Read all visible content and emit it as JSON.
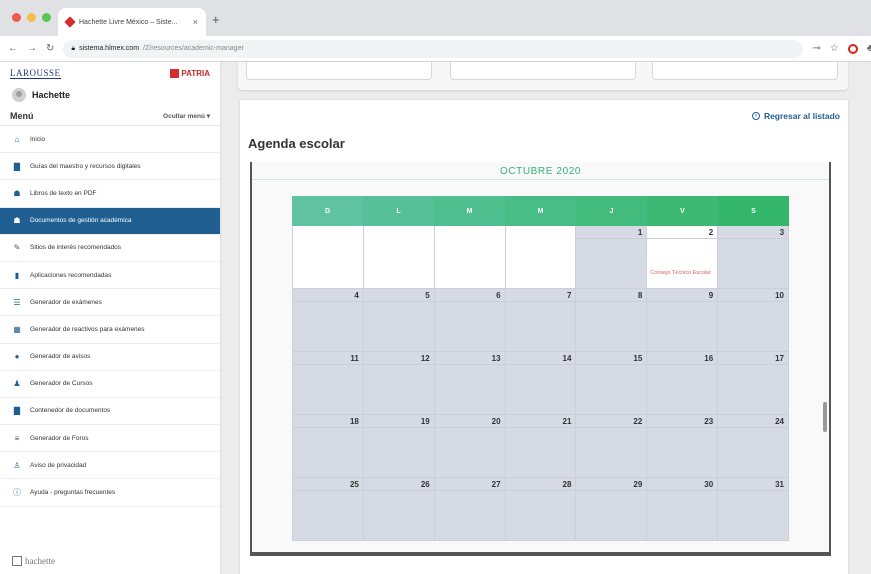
{
  "browser": {
    "tab_title": "Hachette Livre México – Siste...",
    "url_domain": "sistema.hlmex.com",
    "url_path": "/Z/resources/academic-manager",
    "colors": {
      "traffic_red": "#ee5a52",
      "traffic_yellow": "#f4bd4f",
      "traffic_green": "#5bc750"
    }
  },
  "sidebar": {
    "brand_left": "LAROUSSE",
    "brand_right": "PATRIA",
    "user_name": "Hachette",
    "menu_title": "Menú",
    "hide_menu": "Ocultar menú ▾",
    "items": [
      {
        "label": "Inicio",
        "icon": "home-icon",
        "glyph": "⌂"
      },
      {
        "label": "Guías del maestro y recursos digitales",
        "icon": "book-icon",
        "glyph": "▇"
      },
      {
        "label": "Libros de texto en PDF",
        "icon": "users-icon",
        "glyph": "☗"
      },
      {
        "label": "Documentos de gestión académica",
        "icon": "group-icon",
        "glyph": "☗"
      },
      {
        "label": "Sitios de interés recomendados",
        "icon": "link-icon",
        "glyph": "✎"
      },
      {
        "label": "Aplicaciones recomendadas",
        "icon": "phone-icon",
        "glyph": "▮"
      },
      {
        "label": "Generador de exámenes",
        "icon": "list-icon",
        "glyph": "☰"
      },
      {
        "label": "Generador de reactivos para exámenes",
        "icon": "grid-icon",
        "glyph": "▦"
      },
      {
        "label": "Generador de avisos",
        "icon": "info-icon",
        "glyph": "●"
      },
      {
        "label": "Generador de Cursos",
        "icon": "people-icon",
        "glyph": "♟"
      },
      {
        "label": "Contenedor de documentos",
        "icon": "folder-icon",
        "glyph": "▇"
      },
      {
        "label": "Generador de Foros",
        "icon": "chart-icon",
        "glyph": "≡"
      },
      {
        "label": "Aviso de privacidad",
        "icon": "person-icon",
        "glyph": "♙"
      },
      {
        "label": "Ayuda - preguntas frecuentes",
        "icon": "help-icon",
        "glyph": "ⓘ"
      }
    ],
    "active_index": 3,
    "footer_logo": "hachette"
  },
  "main": {
    "back_link": "Regresar al listado",
    "page_title": "Agenda escolar"
  },
  "calendar": {
    "month_title": "OCTUBRE 2020",
    "weekdays": [
      "D",
      "L",
      "M",
      "M",
      "J",
      "V",
      "S"
    ],
    "header_colors": [
      "#5fc3a2",
      "#56c198",
      "#4fbf8f",
      "#49bd86",
      "#43bb7d",
      "#3db973",
      "#33b66a"
    ],
    "weeks": [
      [
        "",
        "",
        "",
        "",
        "1",
        "2",
        "3"
      ],
      [
        "4",
        "5",
        "6",
        "7",
        "8",
        "9",
        "10"
      ],
      [
        "11",
        "12",
        "13",
        "14",
        "15",
        "16",
        "17"
      ],
      [
        "18",
        "19",
        "20",
        "21",
        "22",
        "23",
        "24"
      ],
      [
        "25",
        "26",
        "27",
        "28",
        "29",
        "30",
        "31"
      ]
    ],
    "event": {
      "day": "2",
      "text": "Consejo Técnico Escolar"
    }
  }
}
